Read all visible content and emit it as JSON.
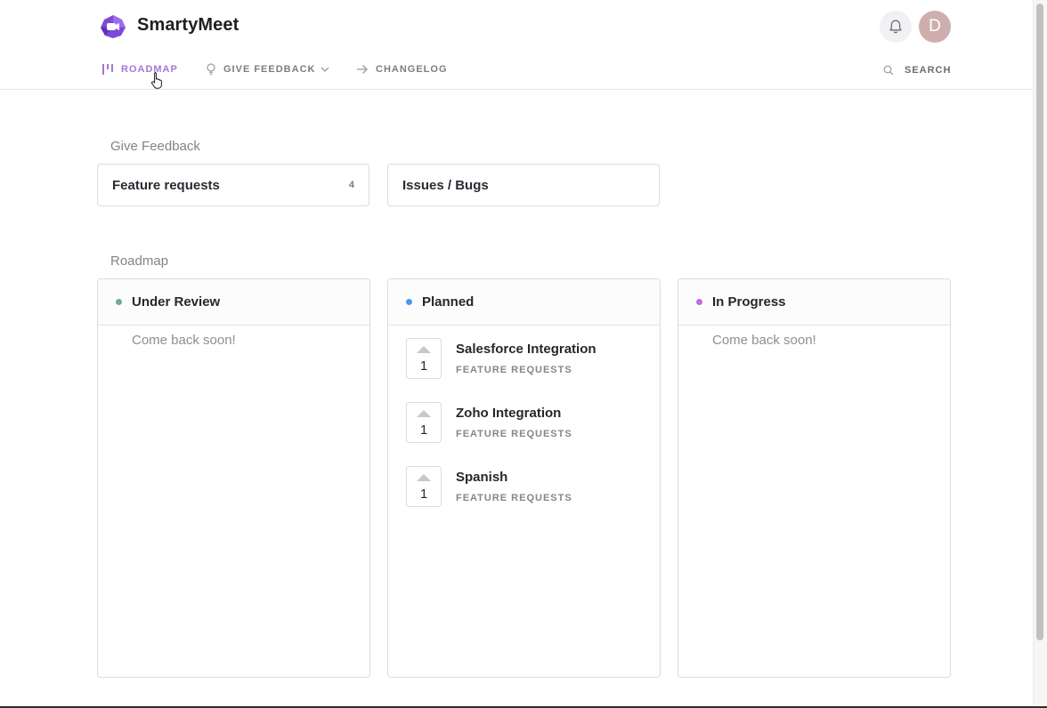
{
  "brand": {
    "name": "SmartyMeet",
    "accent": "#7b4bd8"
  },
  "header": {
    "avatar_initial": "D",
    "nav": [
      {
        "label": "ROADMAP",
        "icon": "roadmap-icon",
        "active": true
      },
      {
        "label": "GIVE FEEDBACK",
        "icon": "lightbulb-icon"
      },
      {
        "label": "CHANGELOG",
        "icon": "arrow-right-icon"
      }
    ],
    "search_label": "SEARCH",
    "active_color": "#a875d6"
  },
  "feedback": {
    "title": "Give Feedback",
    "boards": [
      {
        "name": "Feature requests",
        "count": "4"
      },
      {
        "name": "Issues / Bugs",
        "count": ""
      }
    ]
  },
  "roadmap": {
    "title": "Roadmap",
    "columns": [
      {
        "title": "Under Review",
        "color": "#6fa8a3",
        "empty_text": "Come back soon!",
        "posts": []
      },
      {
        "title": "Planned",
        "color": "#4a9ae8",
        "empty_text": "",
        "posts": [
          {
            "title": "Salesforce Integration",
            "board": "FEATURE REQUESTS",
            "votes": "1"
          },
          {
            "title": "Zoho Integration",
            "board": "FEATURE REQUESTS",
            "votes": "1"
          },
          {
            "title": "Spanish",
            "board": "FEATURE REQUESTS",
            "votes": "1"
          }
        ]
      },
      {
        "title": "In Progress",
        "color": "#c26ce0",
        "empty_text": "Come back soon!",
        "posts": []
      }
    ]
  }
}
